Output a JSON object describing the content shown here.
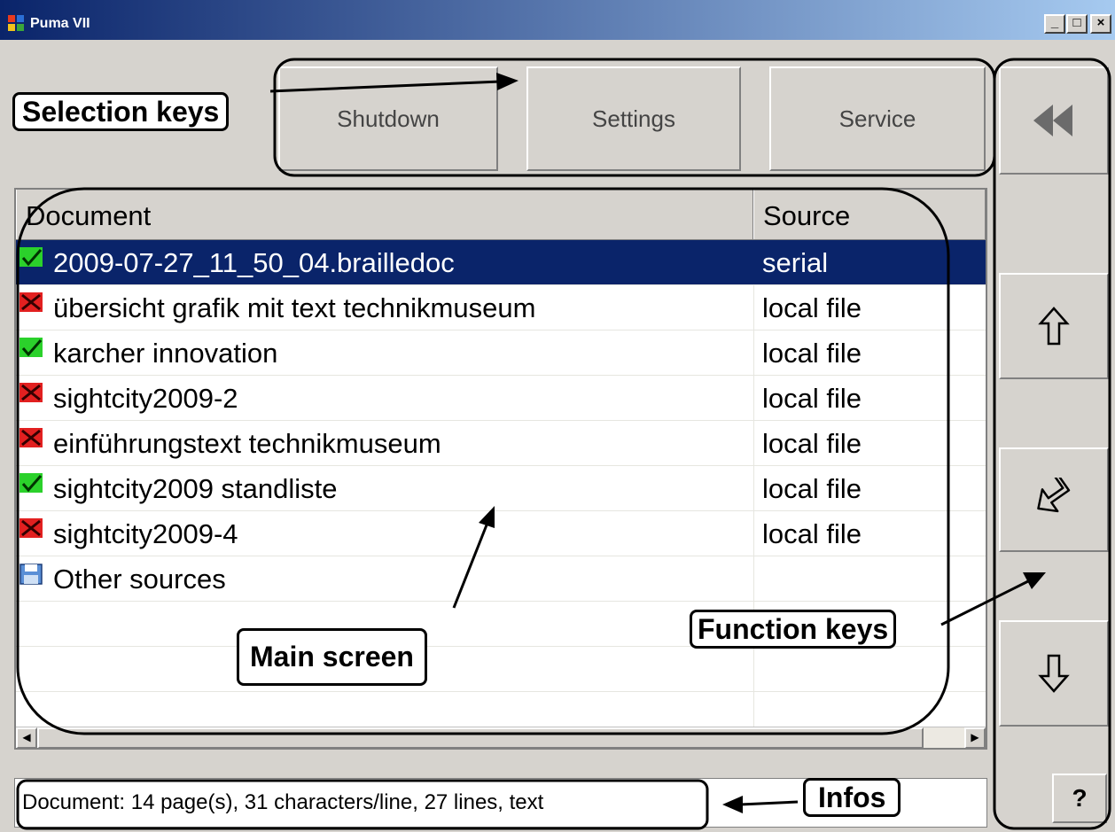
{
  "window": {
    "title": "Puma VII",
    "minimize": "_",
    "maximize": "□",
    "close": "×"
  },
  "selection_keys": [
    "Shutdown",
    "Settings",
    "Service"
  ],
  "list": {
    "columns": [
      "Document",
      "Source"
    ],
    "rows": [
      {
        "status": "check",
        "document": "2009-07-27_11_50_04.brailledoc",
        "source": "serial",
        "selected": true
      },
      {
        "status": "cross",
        "document": "übersicht grafik mit text technikmuseum",
        "source": "local file"
      },
      {
        "status": "check",
        "document": "karcher innovation",
        "source": "local file"
      },
      {
        "status": "cross",
        "document": "sightcity2009-2",
        "source": "local file"
      },
      {
        "status": "cross",
        "document": "einführungstext technikmuseum",
        "source": "local file"
      },
      {
        "status": "check",
        "document": "sightcity2009 standliste",
        "source": "local file"
      },
      {
        "status": "cross",
        "document": "sightcity2009-4",
        "source": "local file"
      },
      {
        "status": "disk",
        "document": "Other sources",
        "source": ""
      }
    ]
  },
  "info_text": "Document: 14 page(s), 31 characters/line, 27 lines, text",
  "annotations": {
    "selection_keys": "Selection keys",
    "main_screen": "Main screen",
    "function_keys": "Function keys",
    "infos": "Infos"
  },
  "help_label": "?",
  "icons": {
    "back": "double-left-arrow-icon",
    "up": "up-arrow-icon",
    "enter": "enter-arrow-icon",
    "down": "down-arrow-icon"
  }
}
